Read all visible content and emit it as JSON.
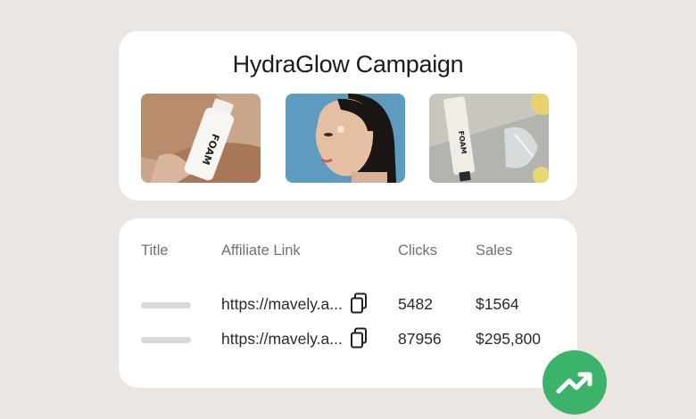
{
  "campaign": {
    "title": "HydraGlow Campaign",
    "images": [
      {
        "icon": "product-bottle-photo",
        "label": "FOAM"
      },
      {
        "icon": "model-portrait-photo"
      },
      {
        "icon": "product-tube-photo",
        "label": "FOAM"
      }
    ]
  },
  "table": {
    "headers": {
      "title": "Title",
      "link": "Affiliate Link",
      "clicks": "Clicks",
      "sales": "Sales"
    },
    "rows": [
      {
        "link": "https://mavely.a...",
        "clicks": "5482",
        "sales": "$1564"
      },
      {
        "link": "https://mavely.a...",
        "clicks": "87956",
        "sales": "$295,800"
      }
    ]
  },
  "badge": {
    "icon": "trending-up-icon",
    "color": "#3cb36a"
  }
}
